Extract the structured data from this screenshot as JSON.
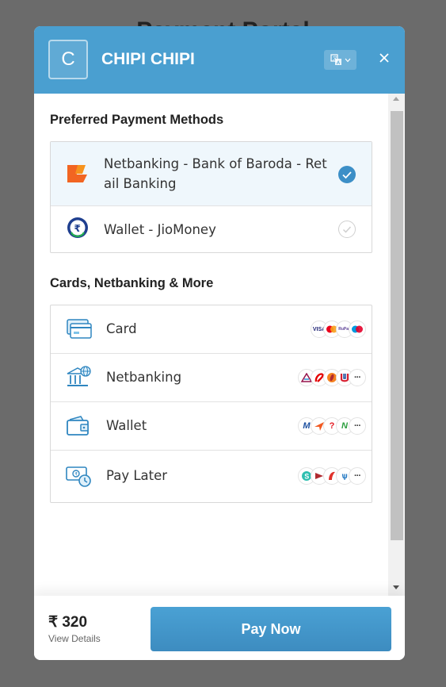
{
  "background_title": "Payment Portal",
  "header": {
    "logo_letter": "C",
    "merchant_name": "CHIPI CHIPI",
    "language_icon": "translate-icon",
    "close_icon": "close-icon",
    "brand_color": "#4a9fd0"
  },
  "preferred": {
    "title": "Preferred Payment Methods",
    "items": [
      {
        "label_line1": "Netbanking - Bank of Baroda - Ret",
        "label_line2": "ail Banking",
        "icon": "bank-of-baroda-icon",
        "selected": true
      },
      {
        "label": "Wallet - JioMoney",
        "icon": "jiomoney-icon",
        "selected": false
      }
    ]
  },
  "methods": {
    "title": "Cards, Netbanking & More",
    "items": [
      {
        "label": "Card",
        "icon": "card-icon",
        "badges": [
          "VISA",
          "MC",
          "RuPay",
          "Maestro"
        ]
      },
      {
        "label": "Netbanking",
        "icon": "bank-icon",
        "badges": [
          "Axis",
          "Airtel",
          "ICICI",
          "Union"
        ],
        "more": "···"
      },
      {
        "label": "Wallet",
        "icon": "wallet-icon",
        "badges": [
          "Mobikwik",
          "Freecharge",
          "Amazon",
          "Nykaa"
        ],
        "more": "···"
      },
      {
        "label": "Pay Later",
        "icon": "paylater-icon",
        "badges": [
          "Simpl",
          "ICICI",
          "Lazypay",
          "Kotak"
        ],
        "more": "···"
      }
    ]
  },
  "footer": {
    "amount": "₹ 320",
    "view_details": "View Details",
    "pay_button": "Pay Now"
  }
}
